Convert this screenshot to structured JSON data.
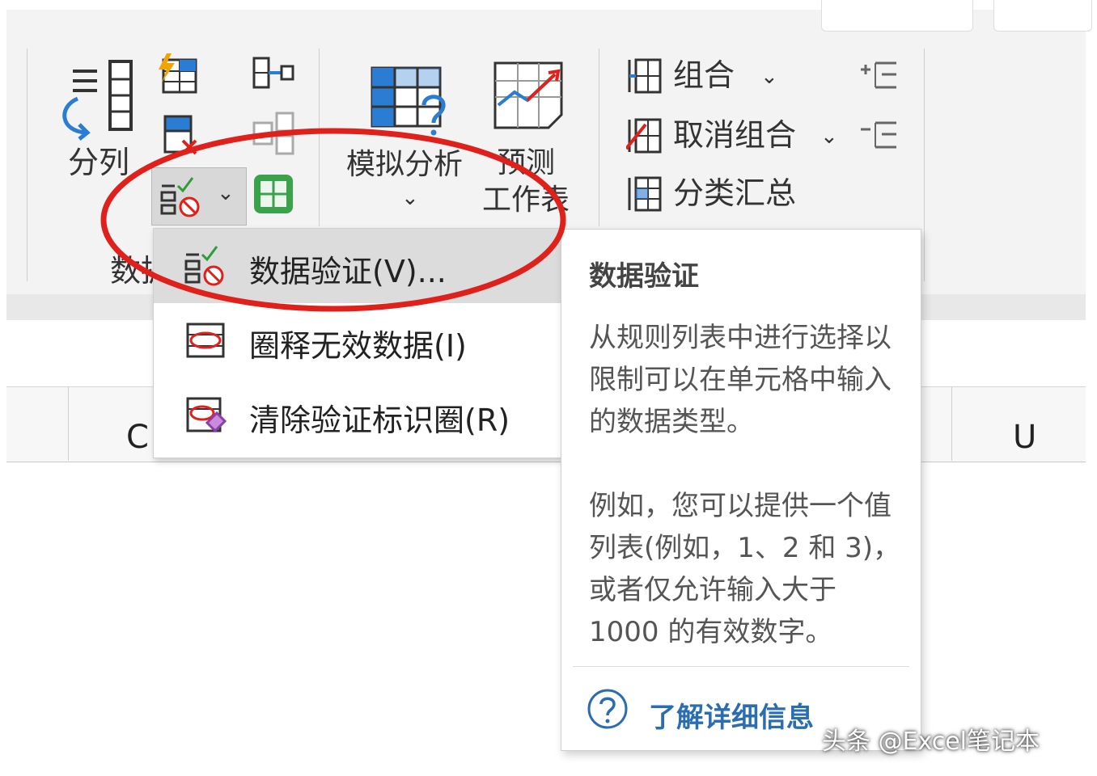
{
  "ribbon": {
    "split_columns_label": "分列",
    "data_tools_group_label": "数据",
    "what_if_analysis_label": "模拟分析",
    "forecast_label_line1": "预测",
    "forecast_label_line2": "工作表",
    "group_label": "组合",
    "ungroup_label": "取消组合",
    "subtotal_label": "分类汇总",
    "dropdown_chevron": "⌄"
  },
  "grid": {
    "col_left": "C",
    "col_right": "U"
  },
  "menu": {
    "items": [
      {
        "label": "数据验证(V)...",
        "icon": "data-validation-icon",
        "highlighted": true
      },
      {
        "label": "圈释无效数据(I)",
        "icon": "circle-invalid-data-icon",
        "highlighted": false
      },
      {
        "label": "清除验证标识圈(R)",
        "icon": "clear-validation-circles-icon",
        "highlighted": false
      }
    ]
  },
  "tooltip": {
    "title": "数据验证",
    "para1": "从规则列表中进行选择以限制可以在单元格中输入的数据类型。",
    "para2": "例如，您可以提供一个值列表(例如，1、2 和 3)，或者仅允许输入大于 1000 的有效数字。",
    "link": "了解详细信息"
  },
  "watermark": "头条 @Excel笔记本",
  "colors": {
    "accent_blue": "#2b7cd3",
    "highlight_red": "#e0201b",
    "link_blue": "#2a6db0"
  }
}
